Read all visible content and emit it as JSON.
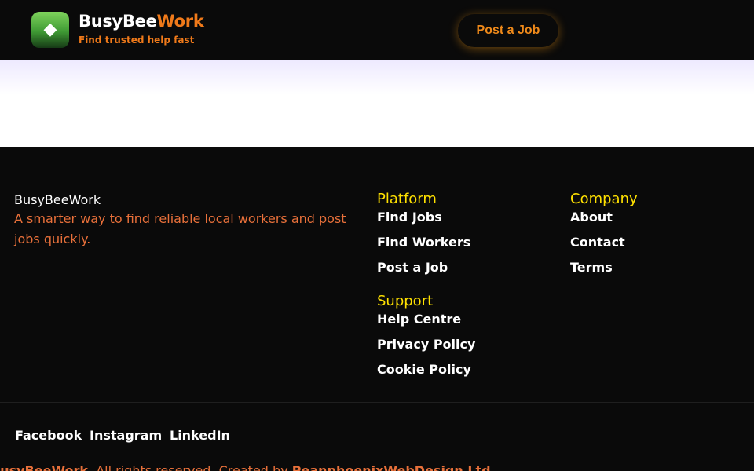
{
  "header": {
    "brand_primary": "BusyBee",
    "brand_accent": "Work",
    "tagline": "Find trusted help fast",
    "logo_icon": "diamond-icon",
    "post_job_label": "Post a Job"
  },
  "footer": {
    "brand": "BusyBeeWork",
    "description": "A smarter way to find reliable local workers and post jobs quickly.",
    "platform": {
      "title": "Platform",
      "links": [
        "Find Jobs",
        "Find Workers",
        "Post a Job"
      ]
    },
    "support": {
      "title": "Support",
      "links": [
        "Help Centre",
        "Privacy Policy",
        "Cookie Policy"
      ]
    },
    "company": {
      "title": "Company",
      "links": [
        "About",
        "Contact",
        "Terms"
      ]
    },
    "social": [
      "Facebook",
      "Instagram",
      "LinkedIn"
    ],
    "copyright": {
      "brand": "BusyBeeWork",
      "text": ". All rights reserved. Created by ",
      "creator": "PeanphoenixWebDesign Ltd"
    }
  },
  "colors": {
    "background": "#0a0a0a",
    "brand_orange": "#f07a1a",
    "heading_yellow": "#ffe100",
    "link_white": "#ffffff",
    "description_orange": "#e8703a",
    "logo_green": "#4caf3c"
  }
}
